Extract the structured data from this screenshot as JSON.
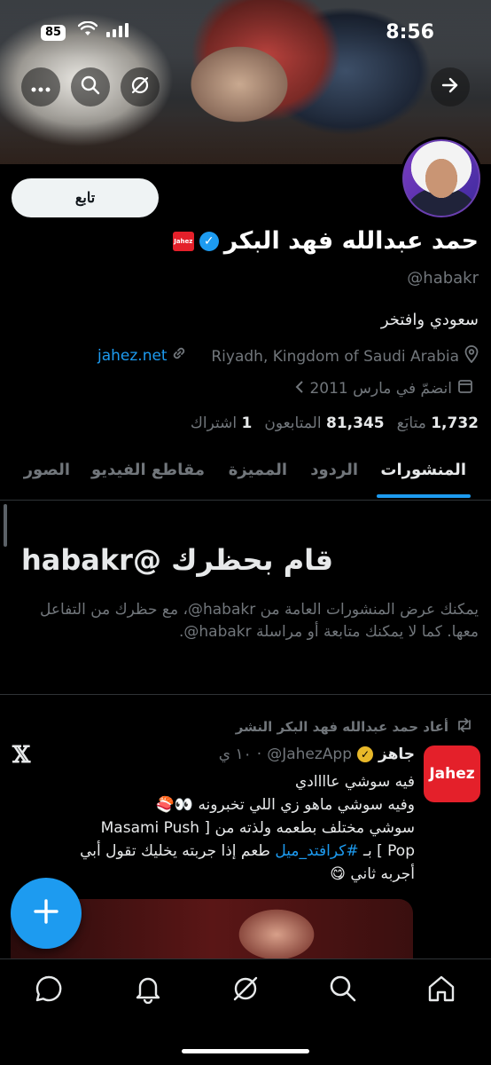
{
  "status_bar": {
    "time": "8:56",
    "battery": "85"
  },
  "profile": {
    "follow_label": "تابع",
    "name": "حمد عبدالله فهد البكر",
    "affiliate_badge": "Jahez",
    "handle": "@habakr",
    "bio": "سعودي وافتخر",
    "location": "Riyadh, Kingdom of Saudi Arabia",
    "website": "jahez.net",
    "joined": "انضمّ في مارس 2011",
    "posts_count": "1,732",
    "posts_label": "متابَع",
    "followers_count": "81,345",
    "followers_label": "المتابعون",
    "subs_count": "1",
    "subs_label": "اشتراك"
  },
  "tabs": [
    "المنشورات",
    "الردود",
    "المميزة",
    "مقاطع الفيديو",
    "الصور"
  ],
  "blocked": {
    "title": "قام بحظرك @habakr",
    "description": "يمكنك عرض المنشورات العامة من habakr@، مع حظرك من التفاعل معها. كما لا يمكنك متابعة أو مراسلة habakr@."
  },
  "post": {
    "repost_label": "أعاد حمد عبدالله فهد البكر النشر",
    "avatar_text": "Jahez",
    "author": "جاهز",
    "author_handle": "@JahezApp",
    "time": "١٠ ي",
    "line1": "فيه سوشي عاااادي",
    "line2": "وفيه سوشي ماهو زي اللي تخبرونه 👀🍣",
    "line3": "سوشي مختلف بطعمه ولذته من [ Masami Push",
    "line4_a": "Pop ] بـ ",
    "hashtag": "#كرافتد_ميل",
    "line4_b": " طعم إذا جربته يخليك تقول أبي",
    "line5": "أجربه ثاني 😋"
  },
  "icons": {
    "back": "arrow-right-icon",
    "search": "search-icon",
    "grok": "grok-icon",
    "more": "more-icon",
    "fab": "plus-icon"
  },
  "colors": {
    "accent": "#1d9bf0",
    "jahez": "#e4202a"
  }
}
